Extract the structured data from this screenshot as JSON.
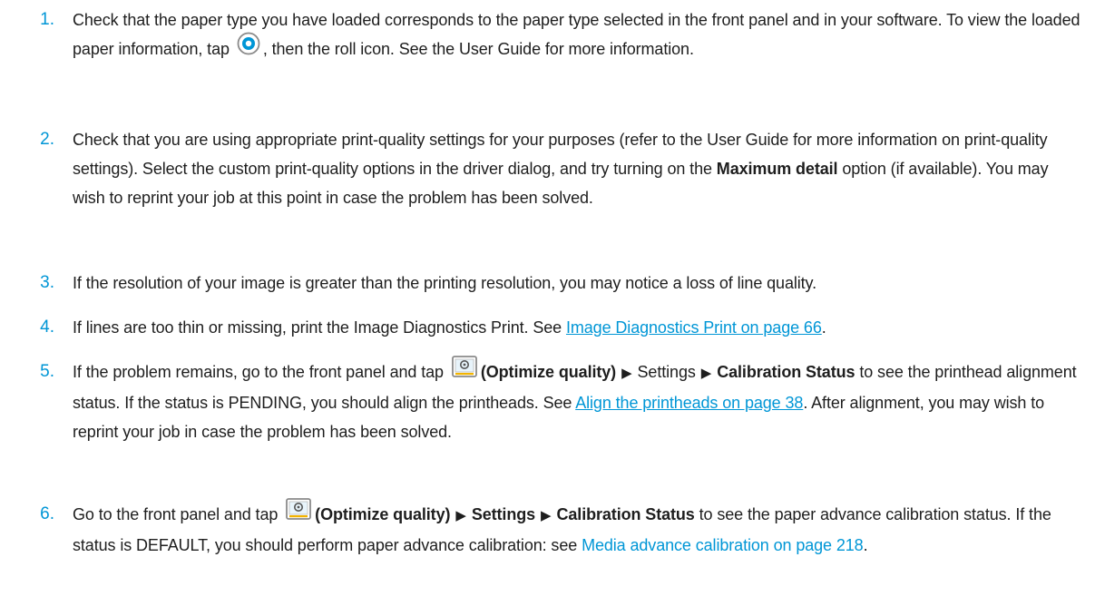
{
  "steps": [
    {
      "number": "1.",
      "pre": "Check that the paper type you have loaded corresponds to the paper type selected in the front panel and in your software. To view the loaded paper information, tap ",
      "post": ", then the roll icon. See the User Guide for more information.",
      "icon": "paper-info-icon"
    },
    {
      "number": "2.",
      "pre": "Check that you are using appropriate print-quality settings for your purposes (refer to the User Guide for more information on print-quality settings). Select the custom print-quality options in the driver dialog, and try turning on the ",
      "bold": "Maximum detail",
      "post": " option (if available). You may wish to reprint your job at this point in case the problem has been solved."
    },
    {
      "number": "3.",
      "text": "If the resolution of your image is greater than the printing resolution, you may notice a loss of line quality."
    },
    {
      "number": "4.",
      "pre": "If lines are too thin or missing, print the Image Diagnostics Print. See ",
      "link": "Image Diagnostics Print on page 66",
      "post": "."
    },
    {
      "number": "5.",
      "pre": "If the problem remains, go to the front panel and tap ",
      "icon": "optimize-quality-icon",
      "bold": "(Optimize quality)",
      "path": [
        "Settings",
        "Calibration Status"
      ],
      "mid": " to see the printhead alignment status. If the status is PENDING, you should align the printheads. See ",
      "link": "Align the printheads on page 38",
      "post": ". After alignment, you may wish to reprint your job in case the problem has been solved."
    },
    {
      "number": "6.",
      "pre": "Go to the front panel and tap ",
      "icon": "optimize-quality-icon",
      "bold": "(Optimize quality)",
      "path": [
        "Settings",
        "Calibration Status"
      ],
      "mid": " to see the paper advance calibration status. If the status is DEFAULT, you should perform paper advance calibration: see ",
      "link": "Media advance calibration on page 218",
      "post": "."
    }
  ],
  "colors": {
    "accent": "#0096d6",
    "text": "#1e1e1e"
  }
}
